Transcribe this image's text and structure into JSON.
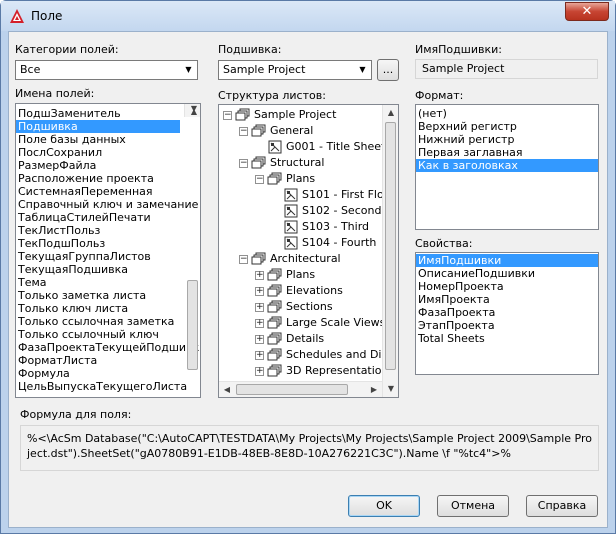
{
  "window": {
    "title": "Поле",
    "close": "✕"
  },
  "categories": {
    "label": "Категории полей:",
    "value": "Все"
  },
  "names": {
    "label": "Имена полей:",
    "items": [
      "ПодшЗаменитель",
      "Подшивка",
      "Поле базы данных",
      "ПослСохранил",
      "РазмерФайла",
      "Расположение проекта",
      "СистемнаяПеременная",
      "Справочный ключ и замечание",
      "ТаблицаСтилейПечати",
      "ТекЛистПольз",
      "ТекПодшПольз",
      "ТекущаяГруппаЛистов",
      "ТекущаяПодшивка",
      "Тема",
      "Только заметка листа",
      "Только ключ листа",
      "Только ссылочная заметка",
      "Только ссылочный ключ",
      "ФазаПроектаТекущейПодшивки",
      "ФорматЛиста",
      "Формула",
      "ЦельВыпускаТекущегоЛиста"
    ]
  },
  "sheetset": {
    "label": "Подшивка:",
    "value": "Sample Project",
    "browse": "..."
  },
  "sheetset_name": {
    "label": "ИмяПодшивки:",
    "value": "Sample Project"
  },
  "structure": {
    "label": "Структура листов:",
    "nodes": [
      {
        "text": "Sample Project",
        "exp": "−"
      },
      {
        "text": "General",
        "exp": "−"
      },
      {
        "text": "G001 - Title Sheet",
        "exp": ""
      },
      {
        "text": "Structural",
        "exp": "−"
      },
      {
        "text": "Plans",
        "exp": "−"
      },
      {
        "text": "S101 - First Floor",
        "exp": ""
      },
      {
        "text": "S102 - Second",
        "exp": ""
      },
      {
        "text": "S103 - Third",
        "exp": ""
      },
      {
        "text": "S104 - Fourth",
        "exp": ""
      },
      {
        "text": "Architectural",
        "exp": "−"
      },
      {
        "text": "Plans",
        "exp": "+"
      },
      {
        "text": "Elevations",
        "exp": "+"
      },
      {
        "text": "Sections",
        "exp": "+"
      },
      {
        "text": "Large Scale Views",
        "exp": "+"
      },
      {
        "text": "Details",
        "exp": "+"
      },
      {
        "text": "Schedules and Diagrams",
        "exp": "+"
      },
      {
        "text": "3D Representations",
        "exp": "+"
      }
    ]
  },
  "format": {
    "label": "Формат:",
    "items": [
      "(нет)",
      "Верхний регистр",
      "Нижний регистр",
      "Первая заглавная",
      "Как в заголовках"
    ]
  },
  "props": {
    "label": "Свойства:",
    "items": [
      "ИмяПодшивки",
      "ОписаниеПодшивки",
      "НомерПроекта",
      "ИмяПроекта",
      "ФазаПроекта",
      "ЭтапПроекта",
      "Total Sheets"
    ]
  },
  "formula": {
    "label": "Формула для поля:",
    "text": "%<\\AcSm Database(\"C:\\AutoCAPT\\TESTDATA\\My Projects\\My Projects\\Sample Project 2009\\Sample Project.dst\").SheetSet(\"gA0780B91-E1DB-48EB-8E8D-10A276221C3C\").Name \\f \"%tc4\">%"
  },
  "buttons": {
    "ok": "OK",
    "cancel": "Отмена",
    "help": "Справка"
  },
  "colors": {
    "selection": "#3399ff"
  }
}
